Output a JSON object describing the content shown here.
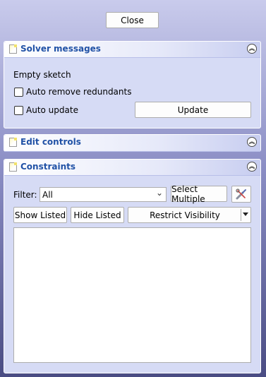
{
  "close_button": "Close",
  "solver_panel": {
    "title": "Solver messages",
    "message": "Empty sketch",
    "auto_remove_redundants": "Auto remove redundants",
    "auto_update": "Auto update",
    "update_button": "Update"
  },
  "edit_controls_panel": {
    "title": "Edit controls"
  },
  "constraints_panel": {
    "title": "Constraints",
    "filter_label": "Filter:",
    "filter_value": "All",
    "select_multiple_button": "Select Multiple",
    "show_listed_button": "Show Listed",
    "hide_listed_button": "Hide Listed",
    "restrict_visibility_button": "Restrict Visibility"
  },
  "icons": {
    "collapse": "double-chevron-up-icon",
    "panel": "sketch-icon",
    "settings": "tools-icon",
    "dropdown": "chevron-down-icon"
  }
}
